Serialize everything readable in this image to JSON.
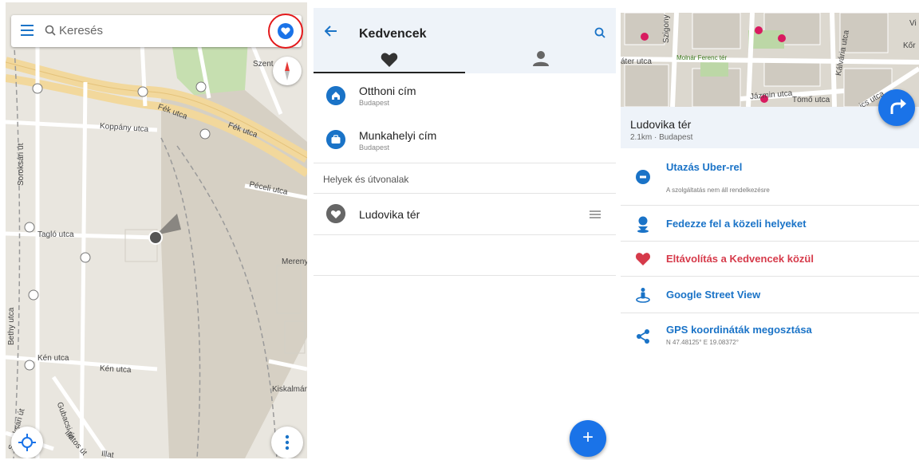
{
  "map_panel": {
    "search_placeholder": "Keresés",
    "icons": [
      "menu-icon",
      "search-icon",
      "favorites-heart-icon",
      "compass-icon",
      "locate-icon",
      "more-icon"
    ],
    "street_labels": [
      "Koppány utca",
      "Fék utca",
      "Fék utca",
      "Péceli utca",
      "Tagló utca",
      "Soroksári út",
      "Kén utca",
      "Kén utca",
      "Bethy utca",
      "Gubacsi út",
      "Illatos út",
      "Kiskalmár",
      "Merenyi",
      "Szent",
      "Soroksári út",
      "Illat"
    ]
  },
  "favorites_panel": {
    "title": "Kedvencek",
    "items": [
      {
        "name": "Otthoni cím",
        "sub": "Budapest",
        "icon": "home-icon"
      },
      {
        "name": "Munkahelyi cím",
        "sub": "Budapest",
        "icon": "briefcase-icon"
      }
    ],
    "section_label": "Helyek és útvonalak",
    "places": [
      {
        "name": "Ludovika tér",
        "icon": "heart-icon"
      }
    ],
    "fab_label": "+"
  },
  "detail_panel": {
    "map_labels": [
      "Szigony u",
      "Vi",
      "Kőr",
      "áter utca",
      "Molnár Ferenc tér",
      "Kálvária utca",
      "Jázmin utca",
      "Tömő utca",
      "ics utca"
    ],
    "place_name": "Ludovika tér",
    "place_sub": "2.1km · Budapest",
    "actions": [
      {
        "label": "Utazás Uber-rel",
        "sub": "A szolgáltatás nem áll rendelkezésre",
        "icon": "uber-icon"
      },
      {
        "label": "Fedezze fel a közeli helyeket",
        "sub": "",
        "icon": "person-pin-icon"
      },
      {
        "label": "Eltávolítás a Kedvencek közül",
        "sub": "",
        "icon": "heart-icon"
      },
      {
        "label": "Google Street View",
        "sub": "",
        "icon": "street-view-icon"
      },
      {
        "label": "GPS koordináták megosztása",
        "sub": "N 47.48125° E 19.08372°",
        "icon": "share-icon"
      }
    ]
  },
  "colors": {
    "accent": "#1a73e8",
    "danger": "#d63a4a",
    "highlight_ring": "#e3191b"
  }
}
